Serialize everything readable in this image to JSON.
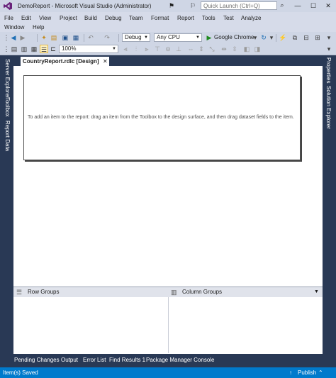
{
  "window": {
    "title": "DemoReport - Microsoft Visual Studio (Administrator)",
    "quick_launch_placeholder": "Quick Launch (Ctrl+Q)"
  },
  "menu": {
    "row1": [
      "File",
      "Edit",
      "View",
      "Project",
      "Build",
      "Debug",
      "Team",
      "Format",
      "Report",
      "Tools",
      "Test",
      "Analyze"
    ],
    "row2": [
      "Window",
      "Help"
    ]
  },
  "toolbar": {
    "config": "Debug",
    "platform": "Any CPU",
    "browser": "Google Chrome",
    "zoom": "100%"
  },
  "side_tabs": {
    "left": [
      "Server Explorer",
      "Toolbox",
      "Report Data"
    ],
    "right": [
      "Properties",
      "Solution Explorer"
    ]
  },
  "document": {
    "tab_label": "CountryReport.rdlc [Design]",
    "hint": "To add an item to the report: drag an item from the Toolbox to the design surface, and then drag dataset fields to the item."
  },
  "grouping": {
    "row_groups": "Row Groups",
    "column_groups": "Column Groups"
  },
  "bottom_tabs": [
    "Pending Changes",
    "Output",
    "Error List",
    "Find Results 1",
    "Package Manager Console"
  ],
  "status": {
    "text": "Item(s) Saved",
    "publish": "Publish"
  },
  "colors": {
    "accent": "#007acc",
    "background": "#293955",
    "chrome": "#cfd6e5",
    "vs_purple": "#68217a"
  }
}
